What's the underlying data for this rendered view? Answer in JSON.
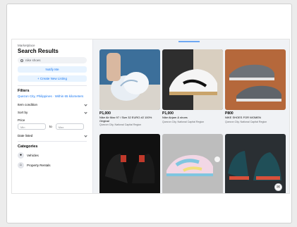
{
  "sidebar": {
    "breadcrumb": "Marketplace",
    "title": "Search Results",
    "search_placeholder": "nike shoes",
    "notify_label": "Notify Me",
    "create_label": "+ Create New Listing",
    "filters_heading": "Filters",
    "location": "Quezon City, Philippines · Within 65 kilometers",
    "filter_condition": "Item condition",
    "filter_sort": "Sort by",
    "price_label": "Price",
    "price_min": "Min",
    "price_to": "to",
    "price_max": "Max",
    "filter_date": "Date listed",
    "categories_heading": "Categories",
    "categories": [
      {
        "label": "Vehicles",
        "icon": "car-icon"
      },
      {
        "label": "Property Rentals",
        "icon": "home-icon"
      }
    ]
  },
  "listings": [
    {
      "price": "P1,000",
      "title": "Nike Air Max 97 / Size 32 EURO #2 100% Original",
      "location": "Quezon City, National Capital Region"
    },
    {
      "price": "P1,000",
      "title": "Nike Airjam & shoes",
      "location": "Quezon City, National Capital Region"
    },
    {
      "price": "P800",
      "title": "NIKE SHOES FOR WOMEN",
      "location": "Quezon City, National Capital Region"
    },
    {
      "price": "",
      "title": "",
      "location": ""
    },
    {
      "price": "",
      "title": "",
      "location": ""
    },
    {
      "price": "",
      "title": "",
      "location": ""
    }
  ]
}
